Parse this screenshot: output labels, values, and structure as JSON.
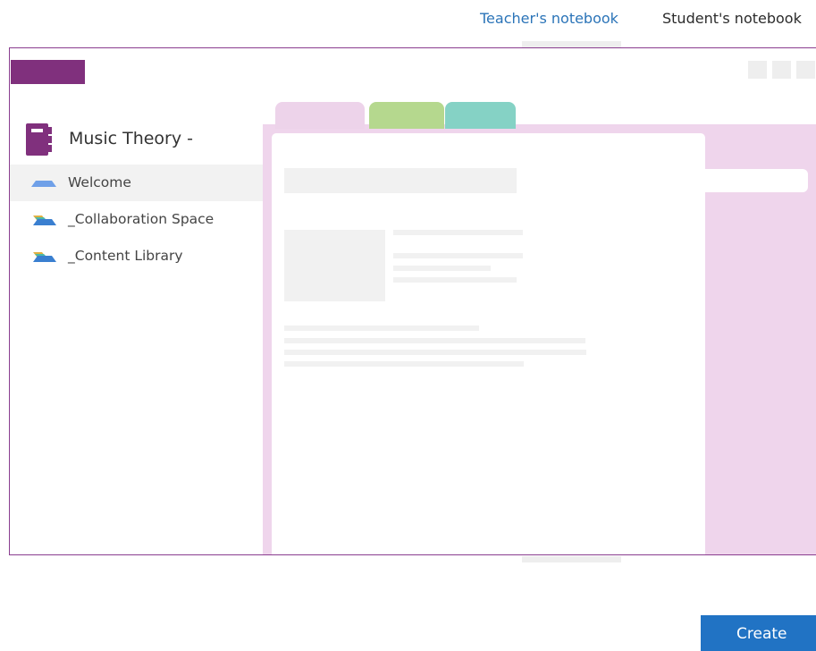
{
  "view_tabs": {
    "teacher": "Teacher's notebook",
    "student": "Student's notebook"
  },
  "notebook": {
    "title": "Music Theory -",
    "icon": "notebook-icon",
    "color": "#80307d"
  },
  "sections": [
    {
      "label": "Welcome",
      "icon": "section-stack-icon",
      "selected": true
    },
    {
      "label": "_Collaboration Space",
      "icon": "section-stack-icon",
      "selected": false
    },
    {
      "label": "_Content Library",
      "icon": "section-stack-icon",
      "selected": false
    }
  ],
  "actions": {
    "create_label": "Create"
  },
  "colors": {
    "accent": "#2173c4",
    "tab_active_text": "#2b74b8",
    "frame_border": "#8a3d8f",
    "preview_pink": "#efd5ec",
    "tab_pink": "#edd3ea",
    "tab_green": "#b5d88e",
    "tab_teal": "#85d2c5"
  }
}
